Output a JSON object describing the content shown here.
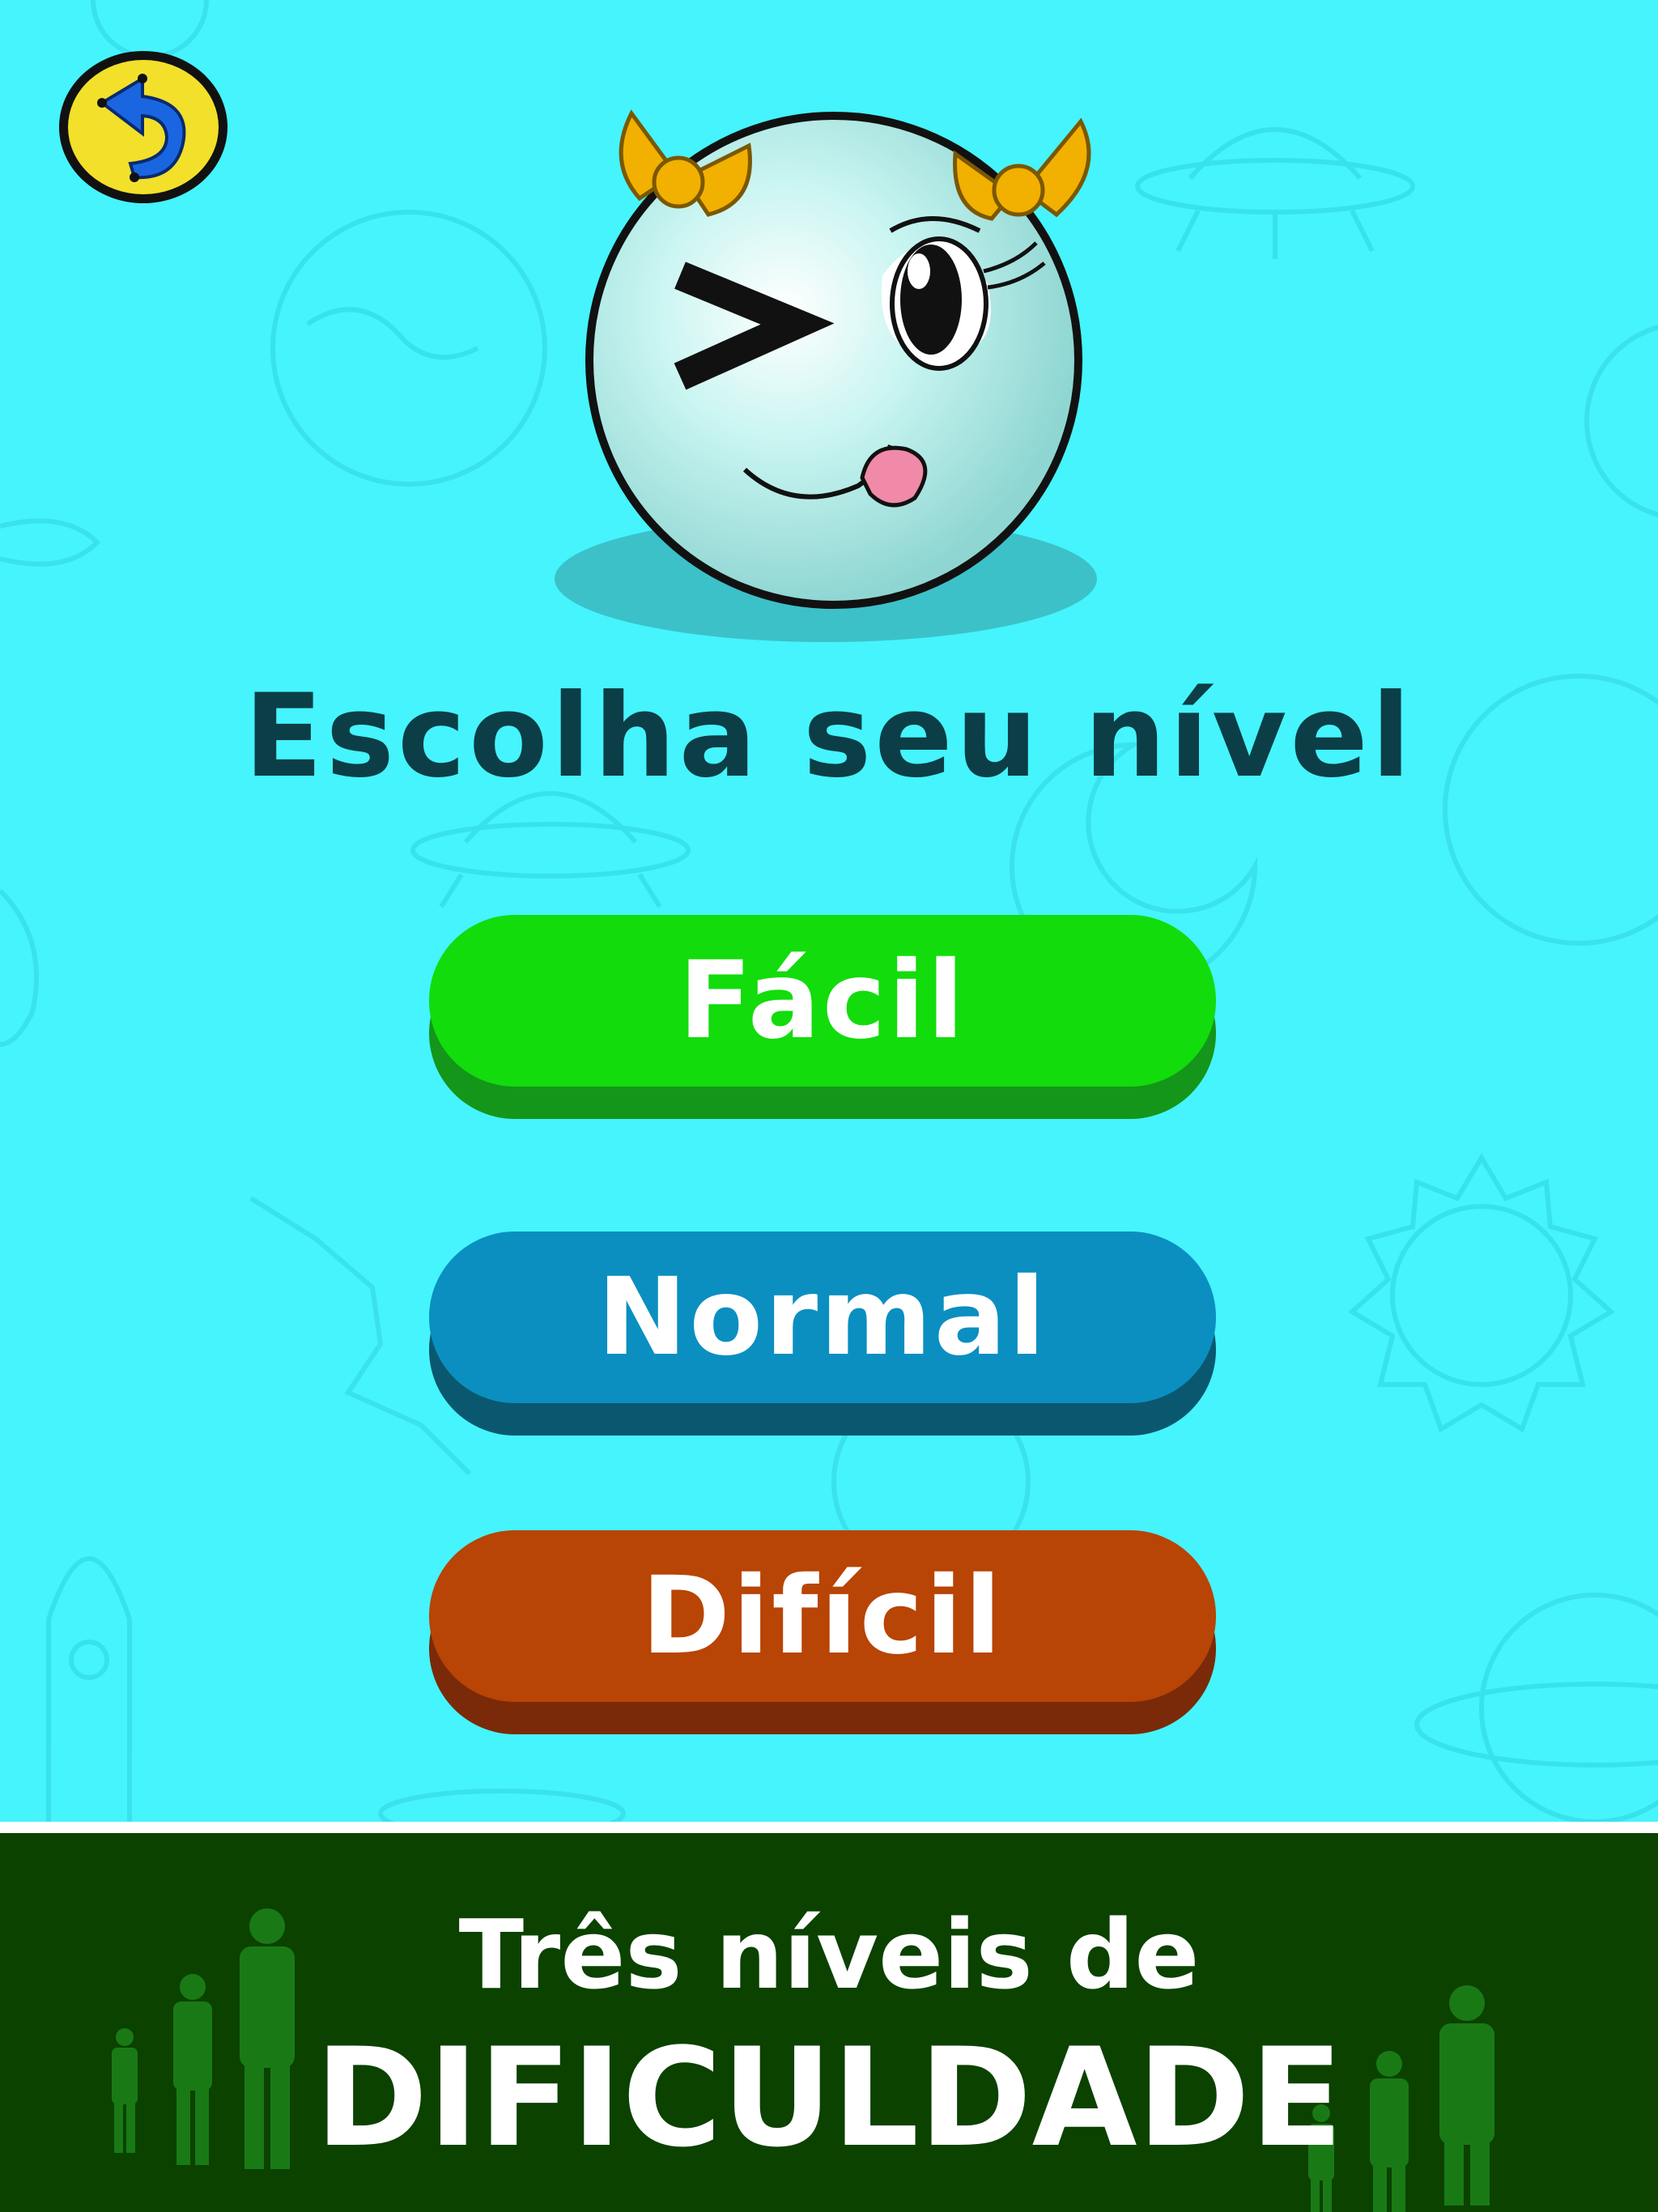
{
  "screen": {
    "title": "Escolha seu nível",
    "background_color": "#45f4fc"
  },
  "back_button": {
    "icon": "back-arrow-icon",
    "color": "#f2e02a",
    "arrow_color": "#1a66e0"
  },
  "mascot": {
    "icon": "winking-ball-mascot"
  },
  "levels": [
    {
      "label": "Fácil",
      "color": "#12dc0c",
      "shadow_color": "#13961a"
    },
    {
      "label": "Normal",
      "color": "#0a8fc0",
      "shadow_color": "#0a5870"
    },
    {
      "label": "Difícil",
      "color": "#b84405",
      "shadow_color": "#7a2a08"
    }
  ],
  "banner": {
    "line1": "Três níveis de",
    "line2": "DIFICULDADE",
    "background_color": "#0b4200"
  }
}
